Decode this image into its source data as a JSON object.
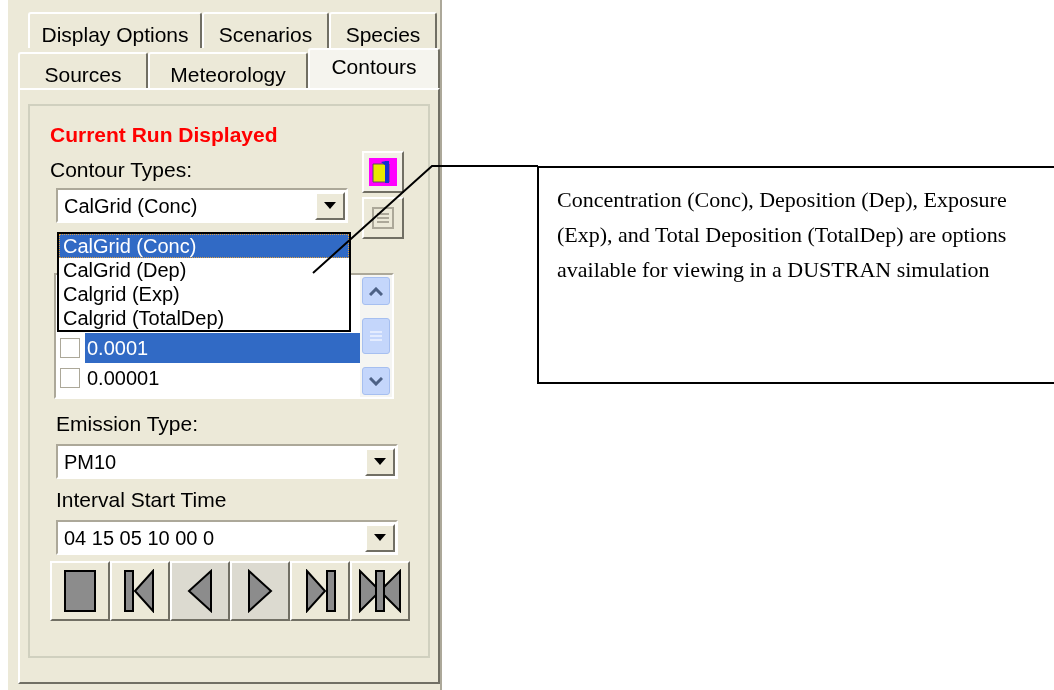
{
  "tab_rows": [
    [
      {
        "label": "Display Options",
        "selected": false
      },
      {
        "label": "Scenarios",
        "selected": false
      },
      {
        "label": "Species",
        "selected": false
      }
    ],
    [
      {
        "label": "Sources",
        "selected": false
      },
      {
        "label": "Meteorology",
        "selected": false
      },
      {
        "label": "Contours",
        "selected": true
      }
    ]
  ],
  "heading": "Current Run Displayed",
  "contour_types": {
    "label": "Contour Types:",
    "value": "CalGrid (Conc)",
    "options": [
      {
        "label": "CalGrid (Conc)",
        "selected": true
      },
      {
        "label": "CalGrid (Dep)",
        "selected": false
      },
      {
        "label": "Calgrid (Exp)",
        "selected": false
      },
      {
        "label": "Calgrid (TotalDep)",
        "selected": false
      }
    ]
  },
  "side_buttons": [
    {
      "kind": "book",
      "disabled": false
    },
    {
      "kind": "list",
      "disabled": true
    }
  ],
  "levels": [
    {
      "label": "0.0001",
      "checked": false,
      "selected": true
    },
    {
      "label": "0.00001",
      "checked": false,
      "selected": false
    }
  ],
  "emission_type": {
    "label": "Emission Type:",
    "value": "PM10"
  },
  "interval_start": {
    "label": "Interval Start Time",
    "value": "04 15 05 10 00 0"
  },
  "media_buttons": [
    {
      "kind": "stop"
    },
    {
      "kind": "first"
    },
    {
      "kind": "previous"
    },
    {
      "kind": "next"
    },
    {
      "kind": "last"
    },
    {
      "kind": "bowtie"
    }
  ],
  "callout": "Concentration (Conc), Deposition (Dep), Exposure (Exp), and Total Deposition (TotalDep) are options available for viewing in a DUSTRAN simulation"
}
